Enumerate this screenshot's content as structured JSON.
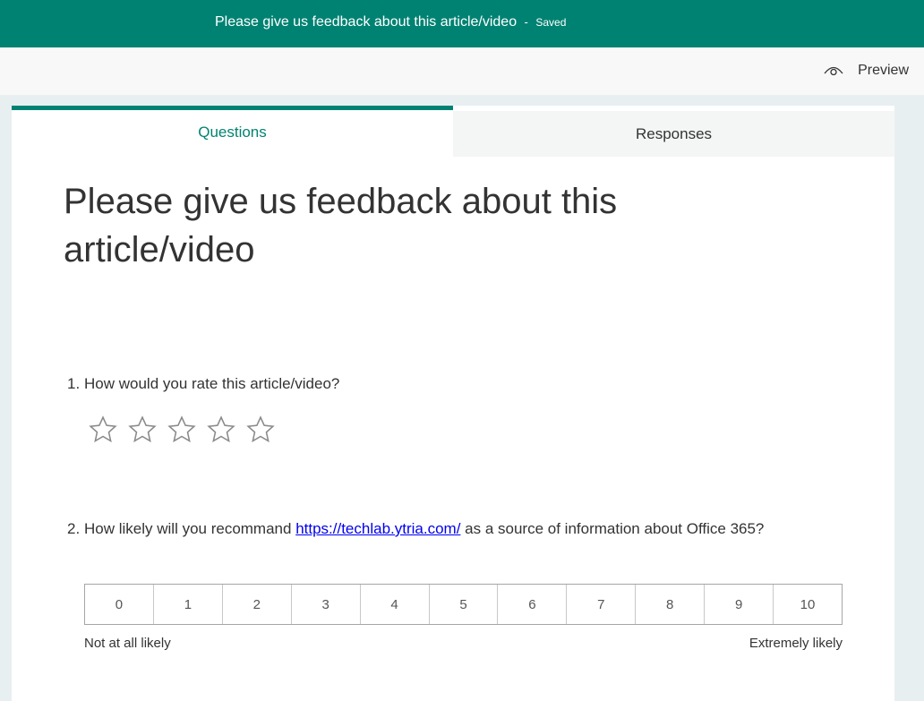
{
  "header": {
    "form_title": "Please give us feedback about this article/video",
    "separator": "-",
    "save_status": "Saved"
  },
  "toolbar": {
    "preview_label": "Preview",
    "preview_icon": "eye-icon"
  },
  "tabs": [
    {
      "label": "Questions",
      "active": true
    },
    {
      "label": "Responses",
      "active": false
    }
  ],
  "form": {
    "title": "Please give us feedback about this article/video"
  },
  "questions": [
    {
      "number": "1.",
      "text": "How would you rate this article/video?",
      "type": "rating",
      "max_stars": 5,
      "selected_stars": 0
    },
    {
      "number": "2.",
      "text_before": "How likely will you recommand ",
      "link_text": "https://techlab.ytria.com/",
      "text_after": "  as a source of information about Office 365?",
      "type": "nps",
      "scale": [
        "0",
        "1",
        "2",
        "3",
        "4",
        "5",
        "6",
        "7",
        "8",
        "9",
        "10"
      ],
      "low_label": "Not at all likely",
      "high_label": "Extremely likely"
    }
  ],
  "colors": {
    "brand": "#008272",
    "link": "#0000ee",
    "star_outline": "#8a8a8a"
  }
}
